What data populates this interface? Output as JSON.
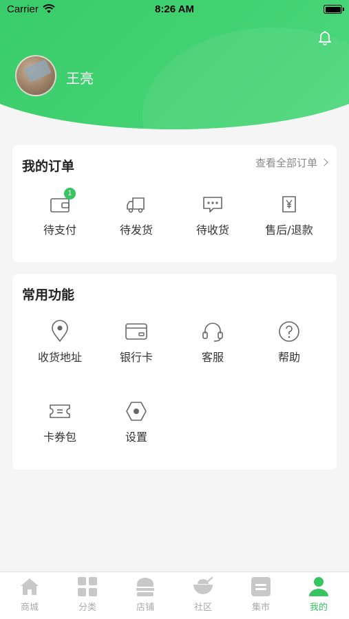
{
  "status_bar": {
    "carrier": "Carrier",
    "time": "8:26 AM"
  },
  "profile": {
    "username": "王亮"
  },
  "orders": {
    "title": "我的订单",
    "view_all": "查看全部订单",
    "items": [
      {
        "label": "待支付",
        "icon": "wallet-icon",
        "badge": "1"
      },
      {
        "label": "待发货",
        "icon": "truck-icon"
      },
      {
        "label": "待收货",
        "icon": "chat-icon"
      },
      {
        "label": "售后/退款",
        "icon": "refund-icon"
      }
    ]
  },
  "functions": {
    "title": "常用功能",
    "items": [
      {
        "label": "收货地址",
        "icon": "location-icon"
      },
      {
        "label": "银行卡",
        "icon": "bank-card-icon"
      },
      {
        "label": "客服",
        "icon": "headset-icon"
      },
      {
        "label": "帮助",
        "icon": "help-icon"
      },
      {
        "label": "卡券包",
        "icon": "coupon-icon"
      },
      {
        "label": "设置",
        "icon": "settings-icon"
      }
    ]
  },
  "tabbar": {
    "items": [
      {
        "label": "商城",
        "icon": "home-icon"
      },
      {
        "label": "分类",
        "icon": "category-icon"
      },
      {
        "label": "店铺",
        "icon": "shop-icon"
      },
      {
        "label": "社区",
        "icon": "community-icon"
      },
      {
        "label": "集市",
        "icon": "market-icon"
      },
      {
        "label": "我的",
        "icon": "profile-icon",
        "active": true
      }
    ]
  },
  "colors": {
    "accent": "#38c460",
    "header": "#3fd06f",
    "tab_inactive": "#aaaaaa"
  }
}
